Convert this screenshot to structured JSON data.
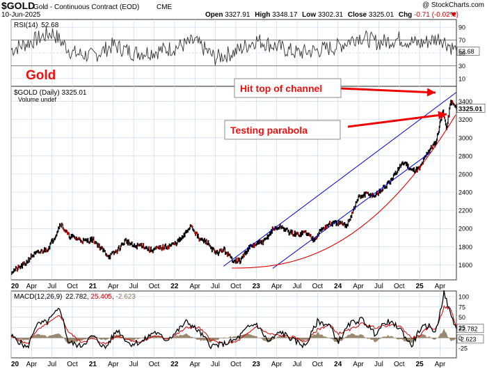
{
  "header": {
    "symbol": "$GOLD",
    "name": "Gold - Continuous Contract (EOD)",
    "exchange": "CME",
    "date": "10-Jun-2025",
    "copyright": "@ StockCharts.com",
    "quote": {
      "open_label": "Open",
      "open": "3327.91",
      "high_label": "High",
      "high": "3348.17",
      "low_label": "Low",
      "low": "3302.31",
      "close_label": "Close",
      "close": "3325.01",
      "chg_label": "Chg",
      "chg": "-0.71 (-0.02%)"
    }
  },
  "rsi_panel": {
    "label": "RSI(14)",
    "value": "52.68",
    "levels": [
      "90",
      "70",
      "50",
      "30",
      "10"
    ],
    "overbought": 70,
    "oversold": 30,
    "big_label": "Gold"
  },
  "price_panel": {
    "legend": "$GOLD (Daily) 3325.01",
    "volume_legend": "Volume undef",
    "last_price_tag": "3325.01",
    "annotations": {
      "hit_top": "Hit top of channel",
      "testing": "Testing parabola"
    }
  },
  "macd_panel": {
    "label": "MACD(12,26,9)",
    "macd": "22.782",
    "signal": "25.405",
    "histogram": "-2.623",
    "ticks": [
      "100",
      "75",
      "50",
      "25",
      "0",
      "-25"
    ]
  },
  "x_axis": {
    "ticks": [
      {
        "label": "20",
        "t": 2020.0,
        "bold": true
      },
      {
        "label": "Apr",
        "t": 2020.25
      },
      {
        "label": "Jul",
        "t": 2020.5
      },
      {
        "label": "Oct",
        "t": 2020.75
      },
      {
        "label": "21",
        "t": 2021.0,
        "bold": true
      },
      {
        "label": "Apr",
        "t": 2021.25
      },
      {
        "label": "Jul",
        "t": 2021.5
      },
      {
        "label": "Oct",
        "t": 2021.75
      },
      {
        "label": "22",
        "t": 2022.0,
        "bold": true
      },
      {
        "label": "Apr",
        "t": 2022.25
      },
      {
        "label": "Jul",
        "t": 2022.5
      },
      {
        "label": "Oct",
        "t": 2022.75
      },
      {
        "label": "23",
        "t": 2023.0,
        "bold": true
      },
      {
        "label": "Apr",
        "t": 2023.25
      },
      {
        "label": "Jul",
        "t": 2023.5
      },
      {
        "label": "Oct",
        "t": 2023.75
      },
      {
        "label": "24",
        "t": 2024.0,
        "bold": true
      },
      {
        "label": "Apr",
        "t": 2024.25
      },
      {
        "label": "Jul",
        "t": 2024.5
      },
      {
        "label": "Oct",
        "t": 2024.75
      },
      {
        "label": "25",
        "t": 2025.0,
        "bold": true
      },
      {
        "label": "Apr",
        "t": 2025.25
      }
    ]
  },
  "colors": {
    "rsi_line": "#333333",
    "rsi_fill": "#999999",
    "price": "#000000",
    "price_down": "#cc0000",
    "channel": "#0000cc",
    "parabola": "#dd0000",
    "annotation": "#ee0000",
    "macd": "#000000",
    "signal": "#cc0000",
    "histogram": "#8b7355",
    "grid": "#c8d8e8"
  },
  "chart_data": [
    {
      "type": "line",
      "title": "RSI(14)",
      "ylim": [
        0,
        100
      ],
      "last_value": 52.68,
      "x": [
        2020.0,
        2020.25,
        2020.5,
        2020.75,
        2021.0,
        2021.25,
        2021.5,
        2021.75,
        2022.0,
        2022.25,
        2022.5,
        2022.75,
        2023.0,
        2023.25,
        2023.5,
        2023.75,
        2024.0,
        2024.25,
        2024.5,
        2024.75,
        2025.0,
        2025.25,
        2025.45
      ],
      "series": [
        {
          "values": [
            55,
            68,
            82,
            50,
            45,
            62,
            50,
            52,
            58,
            68,
            42,
            52,
            70,
            60,
            50,
            54,
            60,
            76,
            66,
            72,
            64,
            74,
            52.68
          ]
        }
      ]
    },
    {
      "type": "line",
      "title": "$GOLD (Daily) 3325.01",
      "ylim": [
        1450,
        3550
      ],
      "x_range": [
        2020.0,
        2025.45
      ],
      "x": [
        2020.0,
        2020.08,
        2020.17,
        2020.25,
        2020.35,
        2020.45,
        2020.55,
        2020.6,
        2020.7,
        2020.8,
        2020.9,
        2021.0,
        2021.1,
        2021.2,
        2021.3,
        2021.4,
        2021.5,
        2021.6,
        2021.7,
        2021.8,
        2021.9,
        2022.0,
        2022.1,
        2022.2,
        2022.3,
        2022.4,
        2022.5,
        2022.6,
        2022.7,
        2022.8,
        2022.9,
        2023.0,
        2023.1,
        2023.2,
        2023.3,
        2023.4,
        2023.5,
        2023.6,
        2023.7,
        2023.8,
        2023.9,
        2024.0,
        2024.1,
        2024.15,
        2024.25,
        2024.35,
        2024.45,
        2024.55,
        2024.65,
        2024.75,
        2024.82,
        2024.9,
        2025.0,
        2025.1,
        2025.2,
        2025.28,
        2025.33,
        2025.38,
        2025.45
      ],
      "series": [
        {
          "name": "$GOLD",
          "values": [
            1525,
            1560,
            1610,
            1700,
            1740,
            1780,
            1940,
            2060,
            1920,
            1890,
            1860,
            1880,
            1780,
            1690,
            1760,
            1870,
            1800,
            1820,
            1760,
            1780,
            1800,
            1830,
            1900,
            2040,
            1880,
            1850,
            1720,
            1770,
            1660,
            1640,
            1780,
            1830,
            1860,
            1990,
            2020,
            1960,
            1930,
            1960,
            1880,
            1990,
            2050,
            2060,
            2030,
            2120,
            2340,
            2380,
            2360,
            2440,
            2520,
            2680,
            2730,
            2640,
            2660,
            2850,
            2950,
            3300,
            3100,
            3400,
            3325.01
          ]
        }
      ]
    },
    {
      "type": "line",
      "title": "MACD(12,26,9)",
      "ylim": [
        -45,
        110
      ],
      "x": [
        2020.0,
        2020.1,
        2020.2,
        2020.3,
        2020.45,
        2020.6,
        2020.7,
        2020.85,
        2021.0,
        2021.15,
        2021.3,
        2021.45,
        2021.6,
        2021.75,
        2021.9,
        2022.0,
        2022.15,
        2022.3,
        2022.45,
        2022.6,
        2022.75,
        2022.9,
        2023.0,
        2023.15,
        2023.3,
        2023.45,
        2023.6,
        2023.75,
        2023.9,
        2024.0,
        2024.15,
        2024.3,
        2024.45,
        2024.6,
        2024.75,
        2024.9,
        2025.0,
        2025.1,
        2025.2,
        2025.3,
        2025.38,
        2025.45
      ],
      "series": [
        {
          "name": "MACD",
          "values": [
            5,
            -10,
            -25,
            30,
            40,
            72,
            -10,
            -20,
            5,
            -25,
            20,
            -15,
            -10,
            15,
            -5,
            10,
            40,
            15,
            -20,
            -15,
            -5,
            25,
            35,
            -10,
            15,
            -5,
            -20,
            40,
            30,
            -10,
            35,
            45,
            10,
            40,
            25,
            -20,
            20,
            30,
            15,
            110,
            55,
            22.782
          ]
        },
        {
          "name": "Signal",
          "values": [
            3,
            -5,
            -15,
            15,
            35,
            55,
            15,
            -10,
            -2,
            -15,
            5,
            -5,
            -10,
            5,
            -2,
            5,
            25,
            25,
            -5,
            -15,
            -10,
            10,
            28,
            10,
            5,
            2,
            -10,
            20,
            32,
            10,
            20,
            35,
            25,
            30,
            30,
            0,
            5,
            25,
            22,
            75,
            70,
            25.405
          ]
        }
      ]
    }
  ]
}
